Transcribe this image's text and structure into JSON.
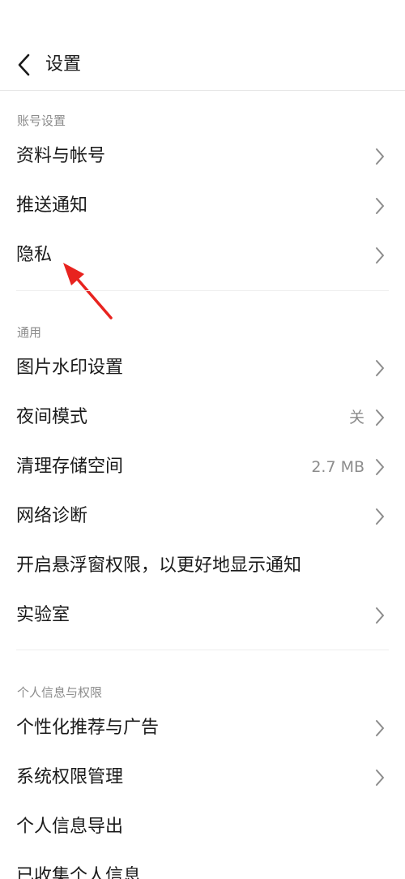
{
  "header": {
    "title": "设置"
  },
  "sections": {
    "account": {
      "label": "账号设置",
      "items": [
        {
          "label": "资料与帐号"
        },
        {
          "label": "推送通知"
        },
        {
          "label": "隐私"
        }
      ]
    },
    "general": {
      "label": "通用",
      "items": [
        {
          "label": "图片水印设置"
        },
        {
          "label": "夜间模式",
          "value": "关"
        },
        {
          "label": "清理存储空间",
          "value": "2.7 MB"
        },
        {
          "label": "网络诊断"
        },
        {
          "label": "开启悬浮窗权限，以更好地显示通知"
        },
        {
          "label": "实验室"
        }
      ]
    },
    "personal": {
      "label": "个人信息与权限",
      "items": [
        {
          "label": "个性化推荐与广告"
        },
        {
          "label": "系统权限管理"
        },
        {
          "label": "个人信息导出"
        },
        {
          "label": "已收集个人信息"
        }
      ]
    }
  },
  "colors": {
    "text_primary": "#1a1a1a",
    "text_secondary": "#8c8c8c",
    "divider": "#eeeeee",
    "annotation_arrow": "#e8231f"
  },
  "icons": {
    "back": "chevron-left-icon",
    "row_chevron": "chevron-right-icon",
    "annotation": "red-arrow-annotation"
  }
}
